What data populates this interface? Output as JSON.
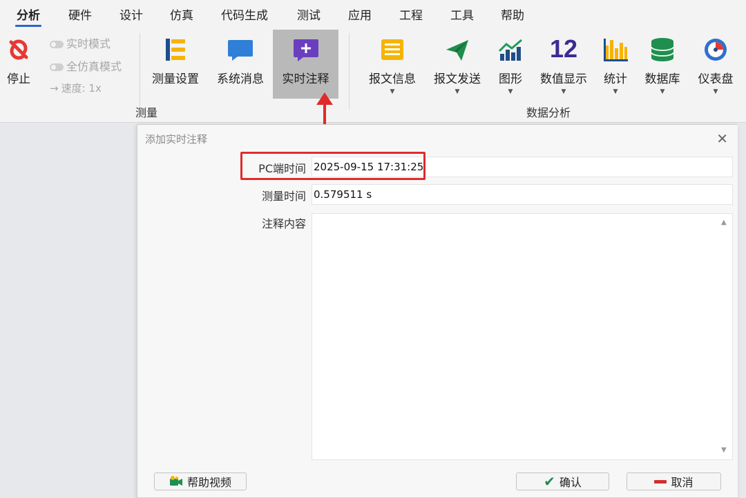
{
  "menu": {
    "tabs": [
      "分析",
      "硬件",
      "设计",
      "仿真",
      "代码生成",
      "测试",
      "应用",
      "工程",
      "工具",
      "帮助"
    ]
  },
  "ribbon": {
    "stop_label": "停止",
    "realtime_mode": "实时模式",
    "full_sim_mode": "全仿真模式",
    "speed": "速度: 1x",
    "measure_settings": "测量设置",
    "system_messages": "系统消息",
    "realtime_annotation": "实时注释",
    "group_measure": "测量",
    "message_info": "报文信息",
    "message_send": "报文发送",
    "graphics": "图形",
    "value_display_icon_text": "12",
    "value_display": "数值显示",
    "statistics": "统计",
    "database": "数据库",
    "dashboard": "仪表盘",
    "group_data_analysis": "数据分析"
  },
  "dialog": {
    "title": "添加实时注释",
    "pc_time_label": "PC端时间",
    "pc_time_value": "2025-09-15 17:31:25",
    "measure_time_label": "测量时间",
    "measure_time_value": "0.579511 s",
    "content_label": "注释内容",
    "content_value": "",
    "help_video": "帮助视频",
    "confirm": "确认",
    "cancel": "取消"
  },
  "colors": {
    "accent_blue": "#2e64c8",
    "annotation_red": "#e12a2a",
    "highlight_gray": "#b9b9b9"
  }
}
